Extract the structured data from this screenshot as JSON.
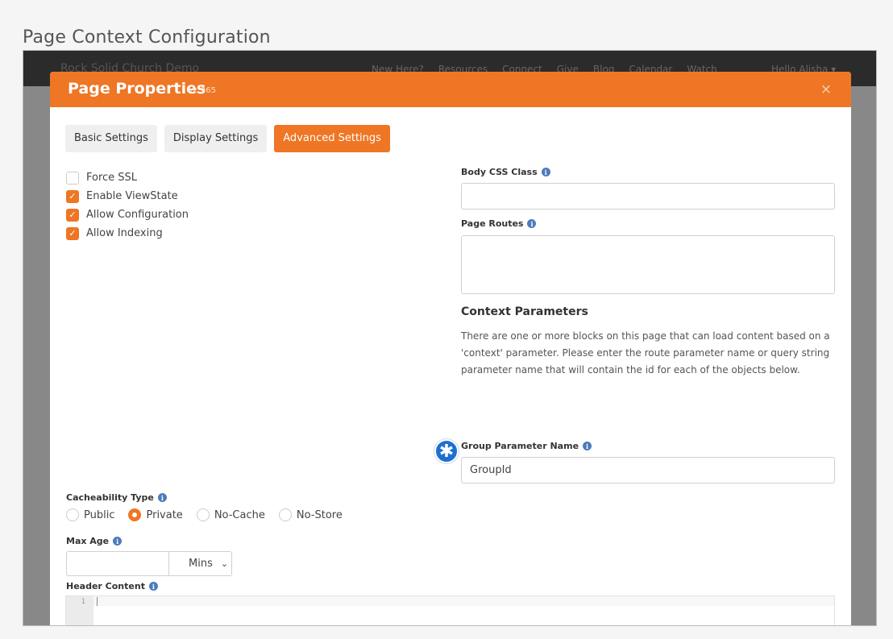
{
  "outer_title": "Page Context Configuration",
  "site": {
    "brand": "Rock Solid Church Demo",
    "nav_links": [
      "New Here?",
      "Resources",
      "Connect",
      "Give",
      "Blog",
      "Calendar",
      "Watch"
    ],
    "user": "Hello Alisha ▾"
  },
  "modal": {
    "title": "Page Properties",
    "id_label": "Id: 365",
    "close_icon": "×"
  },
  "tabs": [
    {
      "label": "Basic Settings",
      "active": false
    },
    {
      "label": "Display Settings",
      "active": false
    },
    {
      "label": "Advanced Settings",
      "active": true
    }
  ],
  "checkboxes": [
    {
      "label": "Force SSL",
      "checked": false
    },
    {
      "label": "Enable ViewState",
      "checked": true
    },
    {
      "label": "Allow Configuration",
      "checked": true
    },
    {
      "label": "Allow Indexing",
      "checked": true
    }
  ],
  "body_css_class": {
    "label": "Body CSS Class",
    "value": ""
  },
  "page_routes": {
    "label": "Page Routes",
    "value": ""
  },
  "context": {
    "heading": "Context Parameters",
    "description": "There are one or more blocks on this page that can load content based on a 'context' parameter. Please enter the route parameter name or query string parameter name that will contain the id for each of the objects below.",
    "group_param": {
      "label": "Group Parameter Name",
      "value": "GroupId"
    }
  },
  "cacheability": {
    "label": "Cacheability Type",
    "options": [
      {
        "label": "Public",
        "checked": false
      },
      {
        "label": "Private",
        "checked": true
      },
      {
        "label": "No-Cache",
        "checked": false
      },
      {
        "label": "No-Store",
        "checked": false
      }
    ]
  },
  "max_age": {
    "label": "Max Age",
    "value": "",
    "unit": "Mins"
  },
  "header_content": {
    "label": "Header Content",
    "line_number": "1"
  },
  "colors": {
    "accent": "#ee7624",
    "info": "#4c7bbd",
    "marker": "#1d6fd1"
  },
  "icons": {
    "info": "info-icon",
    "marker": "asterisk-icon",
    "check": "check-icon",
    "chevron": "chevron-down-icon"
  }
}
